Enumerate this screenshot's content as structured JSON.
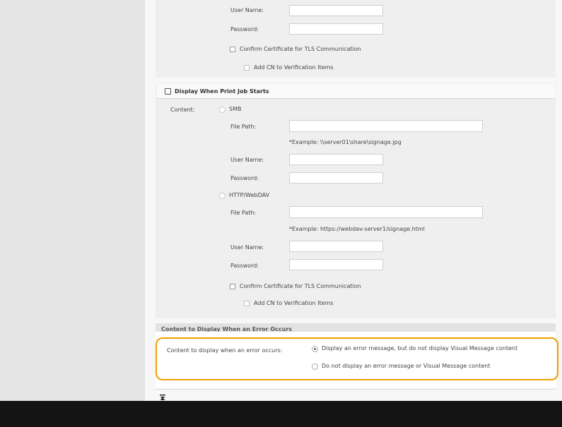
{
  "top": {
    "user_name_label": "User Name:",
    "password_label": "Password:",
    "confirm_tls_label": "Confirm Certificate for TLS Communication",
    "add_cn_label": "Add CN to Verification Items"
  },
  "print_job": {
    "section_title": "Display When Print Job Starts",
    "content_label": "Content:",
    "smb": {
      "label": "SMB",
      "file_path_label": "File Path:",
      "file_path_value": "",
      "example": "*Example: \\\\server01\\share\\signage.jpg",
      "user_name_label": "User Name:",
      "password_label": "Password:"
    },
    "http": {
      "label": "HTTP/WebDAV",
      "file_path_label": "File Path:",
      "file_path_value": "",
      "example": "*Example: https://webdav-server1/signage.html",
      "user_name_label": "User Name:",
      "password_label": "Password:",
      "confirm_tls_label": "Confirm Certificate for TLS Communication",
      "add_cn_label": "Add CN to Verification Items"
    }
  },
  "error": {
    "section_title": "Content to Display When an Error Occurs",
    "content_label": "Content to display when an error occurs:",
    "option_1": "Display an error message, but do not display Visual Message content",
    "option_2": "Do not display an error message or Visual Message content",
    "selected": "option_1"
  },
  "colors": {
    "highlight": "#f0a000",
    "footer": "#141414",
    "sidebar": "#e4e4e4"
  },
  "icons": {
    "scroll_to_top": "arrow-to-top-icon"
  }
}
